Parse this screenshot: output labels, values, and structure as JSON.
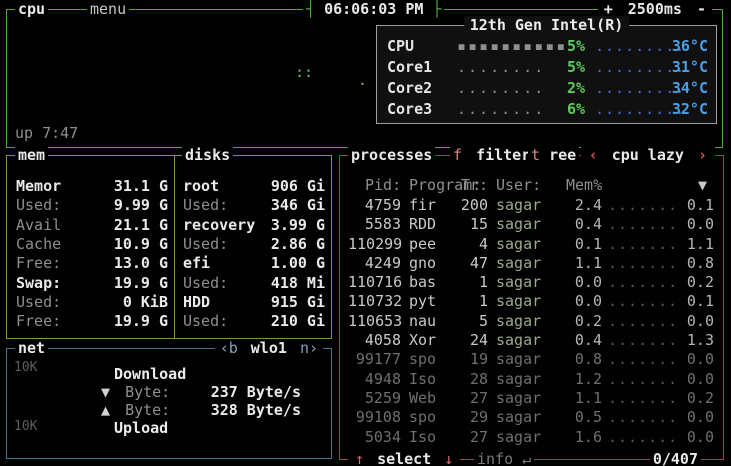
{
  "colors": {
    "background": "#010101",
    "cpu_border": "#4fa83d",
    "mem_border": "#90903a",
    "net_border": "#49758c",
    "proc_border": "#b23b3b",
    "percent_green": "#5fc95f",
    "temp_blue": "#4aa0e8"
  },
  "cpu_box": {
    "title": "cpu",
    "menu": "menu",
    "clock": "06:06:03 PM",
    "clock_brackets": {
      "left": "┤",
      "right": "├"
    },
    "interval": {
      "plus": "+",
      "value": "2500ms",
      "minus": "-"
    },
    "uptime": "up 7:47",
    "graph_dots": {
      "a": "∶∶",
      "b": "·"
    },
    "panel": {
      "title": "12th Gen Intel(R)",
      "rows": [
        {
          "label": "CPU",
          "meter": "▪▪▪▪▪▪▪▪▪▪",
          "pct": "5%",
          "temp_graph": ".........",
          "temp": "36°C"
        },
        {
          "label": "Core1",
          "meter": "........",
          "pct": "5%",
          "temp_graph": ".........",
          "temp": "31°C"
        },
        {
          "label": "Core2",
          "meter": "........",
          "pct": "2%",
          "temp_graph": ".........",
          "temp": "34°C"
        },
        {
          "label": "Core3",
          "meter": "........",
          "pct": "6%",
          "temp_graph": ".........",
          "temp": "32°C"
        }
      ]
    }
  },
  "mem_box": {
    "title": "mem",
    "rows": [
      {
        "label": "Memor",
        "value": "31.1 G"
      },
      {
        "label": "Used:",
        "value": "9.99 G"
      },
      {
        "label": "Avail",
        "value": "21.1 G"
      },
      {
        "label": "Cache",
        "value": "10.9 G"
      },
      {
        "label": "Free:",
        "value": "13.0 G"
      },
      {
        "label": "Swap:",
        "value": "19.9 G"
      },
      {
        "label": "Used:",
        "value": "0 KiB"
      },
      {
        "label": "Free:",
        "value": "19.9 G"
      }
    ]
  },
  "disks_box": {
    "title": "disks",
    "rows": [
      {
        "label": "root",
        "value": "906 Gi"
      },
      {
        "label": "Used:",
        "value": "346 Gi"
      },
      {
        "label": "recovery",
        "value": "3.99 G"
      },
      {
        "label": "Used:",
        "value": "2.86 G"
      },
      {
        "label": "efi",
        "value": "1.00 G"
      },
      {
        "label": "Used:",
        "value": "418 Mi"
      },
      {
        "label": "HDD",
        "value": "915 Gi"
      },
      {
        "label": "Used:",
        "value": "210 Gi"
      }
    ]
  },
  "net_box": {
    "title": "net",
    "iface": {
      "prev_key": "‹b",
      "name": "wlo1",
      "next_key": "n›"
    },
    "scale_top": "10K",
    "scale_bottom": "10K",
    "download_label": "Download",
    "upload_label": "Upload",
    "down": {
      "arrow": "▼",
      "label": "Byte:",
      "value": "237 Byte/s"
    },
    "up": {
      "arrow": "▲",
      "label": "Byte:",
      "value": "328 Byte/s"
    }
  },
  "proc_box": {
    "title": "processes",
    "filter": {
      "key": "f",
      "label": "filter"
    },
    "tree": {
      "key": "t",
      "label": "ree"
    },
    "sort": {
      "left": "‹",
      "label": "cpu lazy",
      "right": "›"
    },
    "header": {
      "pid": "Pid:",
      "program": "Program:",
      "threads": "Tr:",
      "user": "User:",
      "mem": "Mem%",
      "sort_arrow": "▼"
    },
    "rows": [
      {
        "pid": "4759",
        "name": "fir",
        "threads": "200",
        "user": "sagar",
        "mem": "2.4",
        "graph": ".......",
        "cpu": "0.1"
      },
      {
        "pid": "5583",
        "name": "RDD",
        "threads": "15",
        "user": "sagar",
        "mem": "0.4",
        "graph": ".......",
        "cpu": "0.0"
      },
      {
        "pid": "110299",
        "name": "pee",
        "threads": "4",
        "user": "sagar",
        "mem": "0.1",
        "graph": ".......",
        "cpu": "1.1"
      },
      {
        "pid": "4249",
        "name": "gno",
        "threads": "47",
        "user": "sagar",
        "mem": "1.1",
        "graph": ".......",
        "cpu": "0.8"
      },
      {
        "pid": "110716",
        "name": "bas",
        "threads": "1",
        "user": "sagar",
        "mem": "0.0",
        "graph": ".......",
        "cpu": "0.2"
      },
      {
        "pid": "110732",
        "name": "pyt",
        "threads": "1",
        "user": "sagar",
        "mem": "0.0",
        "graph": ".......",
        "cpu": "0.1"
      },
      {
        "pid": "110653",
        "name": "nau",
        "threads": "5",
        "user": "sagar",
        "mem": "0.2",
        "graph": ".......",
        "cpu": "0.0"
      },
      {
        "pid": "4058",
        "name": "Xor",
        "threads": "24",
        "user": "sagar",
        "mem": "0.4",
        "graph": ".......",
        "cpu": "1.3"
      },
      {
        "pid": "99177",
        "name": "spo",
        "threads": "19",
        "user": "sagar",
        "mem": "0.8",
        "graph": ".......",
        "cpu": "0.0"
      },
      {
        "pid": "4948",
        "name": "Iso",
        "threads": "28",
        "user": "sagar",
        "mem": "1.2",
        "graph": ".......",
        "cpu": "0.0"
      },
      {
        "pid": "5259",
        "name": "Web",
        "threads": "27",
        "user": "sagar",
        "mem": "1.1",
        "graph": ".......",
        "cpu": "0.2"
      },
      {
        "pid": "99108",
        "name": "spo",
        "threads": "29",
        "user": "sagar",
        "mem": "0.5",
        "graph": ".......",
        "cpu": "0.0"
      },
      {
        "pid": "5034",
        "name": "Iso",
        "threads": "27",
        "user": "sagar",
        "mem": "1.6",
        "graph": ".......",
        "cpu": "0.0"
      }
    ],
    "footer": {
      "up_arrow": "↑",
      "select": "select",
      "down_arrow": "↓",
      "info": "info ↵",
      "count": "0/407"
    }
  }
}
